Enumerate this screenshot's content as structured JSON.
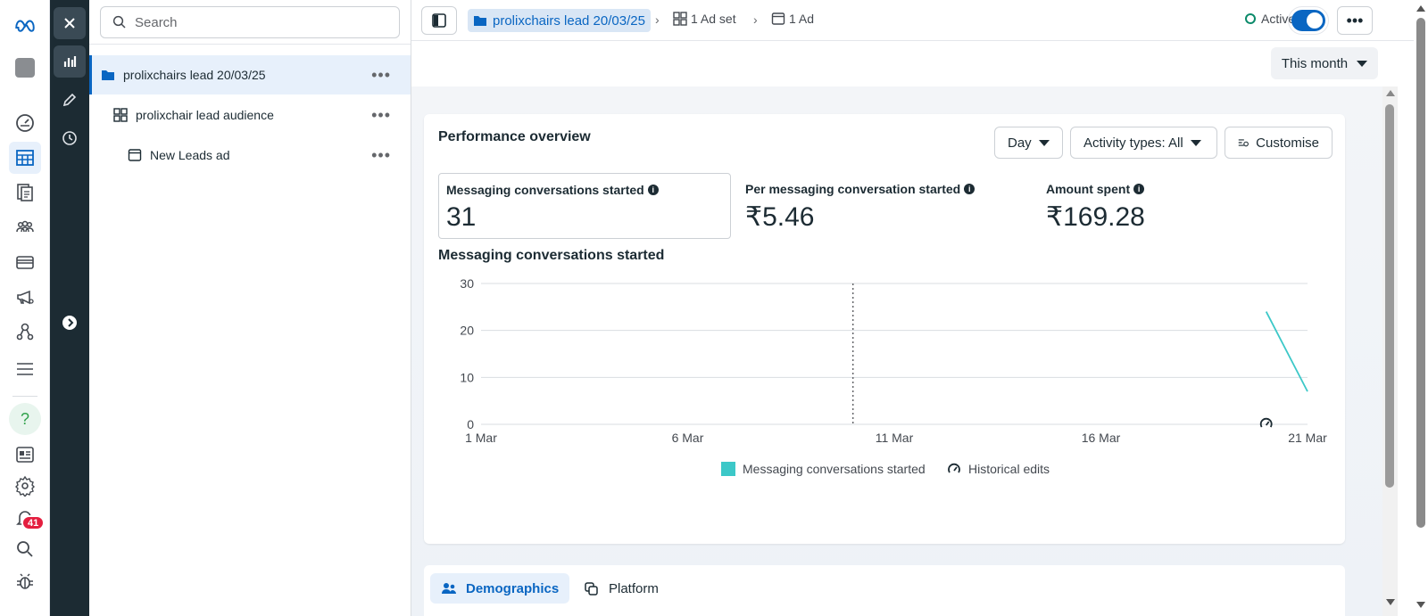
{
  "tree": {
    "search_placeholder": "Search",
    "rows": [
      {
        "label": "prolixchairs lead 20/03/25"
      },
      {
        "label": "prolixchair lead audience"
      },
      {
        "label": "New Leads ad"
      }
    ],
    "more": "•••"
  },
  "rail": {
    "notification_count": "41"
  },
  "topbar": {
    "campaign": "prolixchairs lead 20/03/25",
    "adset": "1 Ad set",
    "ad": "1 Ad",
    "status": "Active",
    "more": "•••"
  },
  "date_range": "This month",
  "overview": {
    "title": "Performance overview",
    "controls": {
      "granularity": "Day",
      "activity": "Activity types: All",
      "customise": "Customise"
    },
    "metrics": [
      {
        "label": "Messaging conversations started",
        "value": "31"
      },
      {
        "label": "Per messaging conversation started",
        "value": "₹5.46"
      },
      {
        "label": "Amount spent",
        "value": "₹169.28"
      }
    ],
    "chart_title": "Messaging conversations started",
    "legend": {
      "series": "Messaging conversations started",
      "edits": "Historical edits"
    }
  },
  "chart_data": {
    "type": "line",
    "title": "Messaging conversations started",
    "x": [
      "20 Mar",
      "21 Mar"
    ],
    "series": [
      {
        "name": "Messaging conversations started",
        "values": [
          24,
          7
        ],
        "color": "#3cc8c8"
      }
    ],
    "ylim": [
      0,
      30
    ],
    "yticks": [
      "30",
      "20",
      "10",
      "0"
    ],
    "xticks": [
      "1 Mar",
      "6 Mar",
      "11 Mar",
      "16 Mar",
      "21 Mar"
    ],
    "grid": true,
    "today_marker": "10 Mar",
    "historical_edit_at": "20 Mar"
  },
  "tabs": [
    {
      "label": "Demographics",
      "active": true
    },
    {
      "label": "Platform",
      "active": false
    }
  ]
}
